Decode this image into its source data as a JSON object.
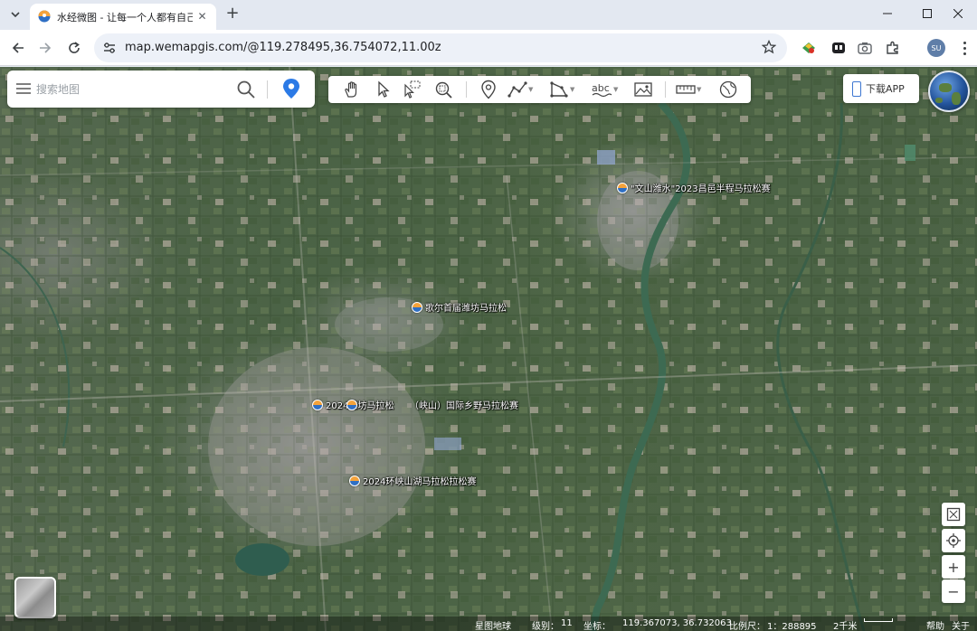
{
  "browser": {
    "tab": {
      "title": "水经微图 - 让每一个人都有自己",
      "close": "✕"
    },
    "new_tab": "+",
    "url": "map.wemapgis.com/@119.278495,36.754072,11.00z",
    "profile_initials": "SU",
    "window_controls": [
      "minimize",
      "maximize",
      "close"
    ]
  },
  "search": {
    "placeholder": "搜索地图"
  },
  "toolbar": {
    "tools": [
      "pan-hand-icon",
      "select-arrow-icon",
      "select-box-icon",
      "zoom-to-area-icon",
      "marker-point-icon",
      "polyline-icon",
      "polygon-icon",
      "text-label-icon",
      "image-icon",
      "measure-ruler-icon",
      "globe-3d-icon"
    ]
  },
  "download_app": "下载APP",
  "markers": [
    {
      "label": "\"文山潍水\"2023昌邑半程马拉松赛"
    },
    {
      "label": "歌尔首届潍坊马拉松"
    },
    {
      "label": "2024潍坊马拉松"
    },
    {
      "label": "（峡山）国际乡野马拉松赛"
    },
    {
      "label": "2024环峡山湖马拉松拉松赛"
    }
  ],
  "map_controls": {
    "zoom_in": "+",
    "zoom_out": "−"
  },
  "status": {
    "layer": "星图地球",
    "level_label": "级别：",
    "level": "11",
    "coord_label": "坐标：",
    "coords": "119.367073, 36.732063",
    "scale_label": "比例尺：",
    "scale": "1：288895",
    "distance": "2千米",
    "help": "帮助",
    "about": "关于"
  }
}
